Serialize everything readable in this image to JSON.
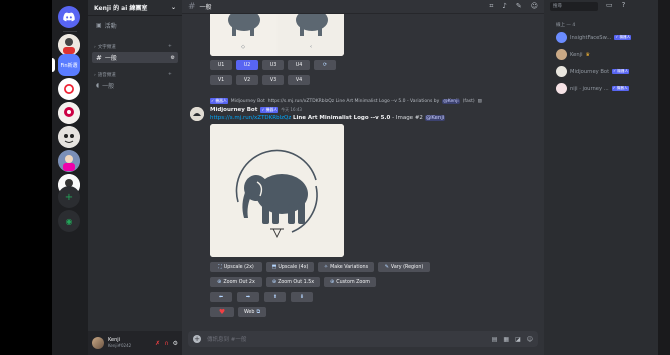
{
  "guild": {
    "name": "Kenji 的 ai 練團室"
  },
  "channels": {
    "top": {
      "label": "活動"
    },
    "category_text": "文字頻道",
    "general": {
      "label": "一般"
    },
    "category_voice": "語音頻道",
    "voice_general": {
      "label": "一般"
    }
  },
  "servers": {
    "ai_badge": "Fin新選"
  },
  "user": {
    "name": "Kenji",
    "tag": "Kenji#0242"
  },
  "header": {
    "channel": "一般"
  },
  "first_message": {
    "buttons": [
      "U1",
      "U2",
      "U3",
      "U4",
      "V1",
      "V2",
      "V3",
      "V4"
    ],
    "active_button": "U2"
  },
  "message": {
    "reply_author": "Midjourney Bot",
    "reply_text": "https://s.mj.run/xZTDKRblzQz Line Art Minimalist Logo --v 5.0 - Variations by",
    "reply_mention": "@Kenji",
    "reply_suffix": "(fast)",
    "author": "Midjourney Bot",
    "bot_tag": "✓ 機器人",
    "time": "今天 16:43",
    "prompt_link": "https://s.mj.run/xZTDKRblzQz",
    "prompt_text": "Line Art Minimalist Logo --v 5.0",
    "prompt_suffix": "- Image #2",
    "prompt_mention": "@Kenji"
  },
  "buttons": {
    "upscale2x": "Upscale (2x)",
    "upscale4x": "Upscale (4x)",
    "make_variations": "Make Variations",
    "vary_region": "Vary (Region)",
    "zoom_out_2x": "Zoom Out 2x",
    "zoom_out_15x": "Zoom Out 1.5x",
    "custom_zoom": "Custom Zoom",
    "web": "Web"
  },
  "composer": {
    "placeholder": "傳訊息到 #一般"
  },
  "members": {
    "search_placeholder": "搜尋",
    "role_header": "線上 — 4",
    "list": [
      {
        "name": "InsightFaceSw...",
        "tag": "✓ 機器人",
        "color": "#6b8cff"
      },
      {
        "name": "Kenji",
        "tag": "",
        "color": "#caa986"
      },
      {
        "name": "Midjourney Bot",
        "tag": "✓ 機器人",
        "color": "#e9e6df"
      },
      {
        "name": "niji · journey ...",
        "tag": "✓ 機器人",
        "color": "#f6e3e6"
      }
    ]
  },
  "colors": {
    "accent": "#5865f2",
    "link": "#00a8fc",
    "background": "#313338"
  }
}
